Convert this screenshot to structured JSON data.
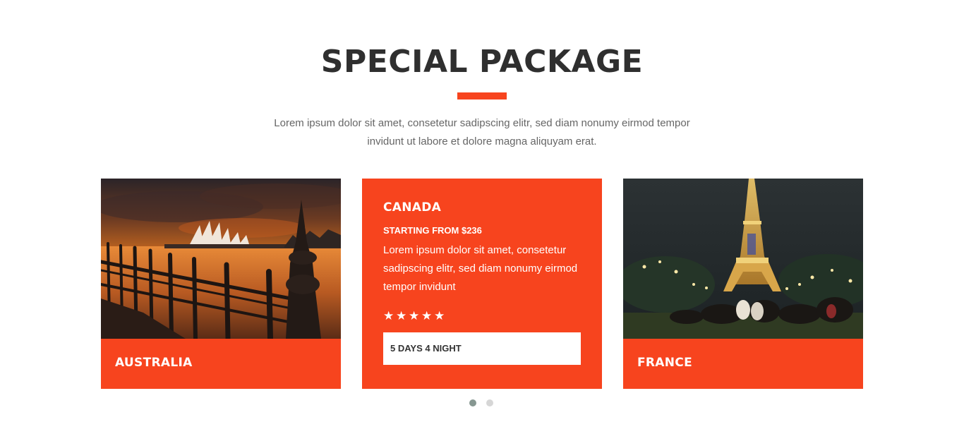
{
  "section": {
    "title": "SPECIAL PACKAGE",
    "description": "Lorem ipsum dolor sit amet, consetetur sadipscing elitr, sed diam nonumy eirmod tempor invidunt ut labore et dolore magna aliquyam erat."
  },
  "packages": [
    {
      "title": "AUSTRALIA",
      "image": "sydney-opera-house-sunset-photo"
    },
    {
      "title": "CANADA",
      "price": "STARTING FROM $236",
      "description": "Lorem ipsum dolor sit amet, consetetur sadipscing elitr, sed diam nonumy eirmod tempor invidunt",
      "rating": 5,
      "stars": "★★★★★",
      "duration": "5 DAYS 4 NIGHT"
    },
    {
      "title": "FRANCE",
      "image": "eiffel-tower-night-photo"
    }
  ],
  "carousel": {
    "pages": 2,
    "active": 1
  },
  "colors": {
    "accent": "#f7441e",
    "heading": "#2f2f2f",
    "body_text": "#666666",
    "dot_active": "#869791",
    "dot_inactive": "#d6d6d6"
  }
}
